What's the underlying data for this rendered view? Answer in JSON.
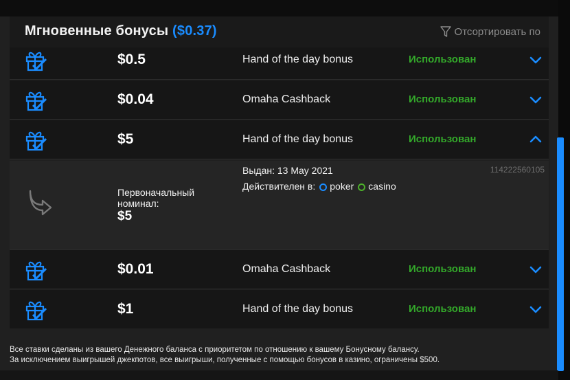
{
  "header": {
    "title": "Мгновенные бонусы",
    "total": "($0.37)",
    "sort_label": "Отсортировать по",
    "sort_icon": "filter-icon"
  },
  "bonuses": [
    {
      "amount": "$0.5",
      "name": "Hand of the day bonus",
      "status": "Использован",
      "expanded": false
    },
    {
      "amount": "$0.04",
      "name": "Omaha Cashback",
      "status": "Использован",
      "expanded": false
    },
    {
      "amount": "$5",
      "name": "Hand of the day bonus",
      "status": "Использован",
      "expanded": true
    },
    {
      "amount": "$0.01",
      "name": "Omaha Cashback",
      "status": "Использован",
      "expanded": false
    },
    {
      "amount": "$1",
      "name": "Hand of the day bonus",
      "status": "Использован",
      "expanded": false
    }
  ],
  "details": {
    "issued": "Выдан: 13 May 2021",
    "valid_label": "Действителен в:",
    "products": [
      "poker",
      "casino"
    ],
    "id": "114222560105",
    "original_label": "Первоначальный номинал:",
    "original_value": "$5"
  },
  "footer": {
    "line1": "Все ставки сделаны из вашего Денежного баланса с приоритетом по отношению к вашему Бонусному балансу.",
    "line2": "За исключением выигрышей джекпотов, все выигрыши, полученные с помощью бонусов в казино, ограничены $500."
  },
  "colors": {
    "accent": "#1a8cff",
    "status_used": "#33a82a",
    "casino": "#4caf2a"
  }
}
